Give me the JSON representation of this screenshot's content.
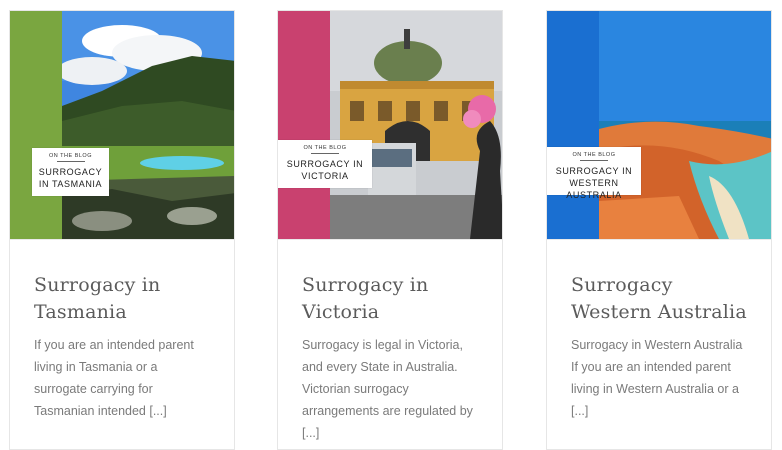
{
  "cards": [
    {
      "stripe_color": "#7aa640",
      "badge_small": "On the blog",
      "badge_title": "Surrogacy in Tasmania",
      "title": "Surrogacy in Tasmania",
      "excerpt": "If you are an intended parent living in Tasmania or a surrogate carrying for Tasmanian intended [...]"
    },
    {
      "stripe_color": "#c9416f",
      "badge_small": "On the blog",
      "badge_title": "Surrogacy in Victoria",
      "title": "Surrogacy in Victoria",
      "excerpt": "Surrogacy is legal in Victoria, and every State in Australia. Victorian surrogacy arrangements are regulated by [...]"
    },
    {
      "stripe_color": "#1a6fd1",
      "badge_small": "On the blog",
      "badge_title": "Surrogacy in Western Australia",
      "title": "Surrogacy Western Australia",
      "excerpt": "Surrogacy in Western Australia If you are an intended parent living in Western Australia or a [...]"
    }
  ]
}
